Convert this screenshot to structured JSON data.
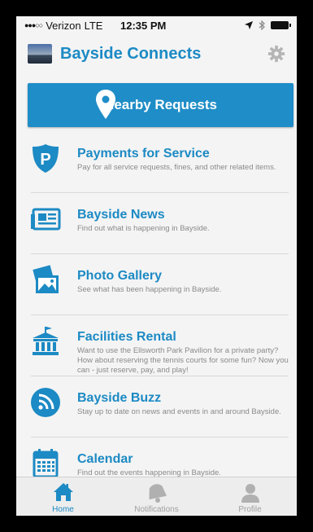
{
  "status": {
    "carrier": "Verizon",
    "network": "LTE",
    "time": "12:35 PM",
    "signal_dots": "●●●○○"
  },
  "app": {
    "title": "Bayside Connects",
    "accent": "#1c8ac4"
  },
  "nearby": {
    "label": "Nearby Requests",
    "icon": "map-pin-icon"
  },
  "items": [
    {
      "title": "Payments for Service",
      "desc": "Pay for all service requests, fines, and other related items.",
      "icon": "parking-shield-icon"
    },
    {
      "title": "Bayside News",
      "desc": "Find out what is happening in Bayside.",
      "icon": "newspaper-icon"
    },
    {
      "title": "Photo Gallery",
      "desc": "See what has been happening in Bayside.",
      "icon": "photo-gallery-icon"
    },
    {
      "title": "Facilities Rental",
      "desc": "Want to use the Ellsworth Park Pavilion for a private party?  How about reserving the tennis courts for some fun?  Now you can - just reserve, pay, and play!",
      "icon": "building-columns-icon"
    },
    {
      "title": "Bayside Buzz",
      "desc": "Stay up to date on news and events in and around Bayside.",
      "icon": "rss-icon"
    },
    {
      "title": "Calendar",
      "desc": "Find out the events happening in Bayside.",
      "icon": "calendar-icon"
    }
  ],
  "tabs": [
    {
      "label": "Home",
      "icon": "home-icon",
      "active": true
    },
    {
      "label": "Notifications",
      "icon": "bell-icon",
      "active": false
    },
    {
      "label": "Profile",
      "icon": "person-icon",
      "active": false
    }
  ]
}
